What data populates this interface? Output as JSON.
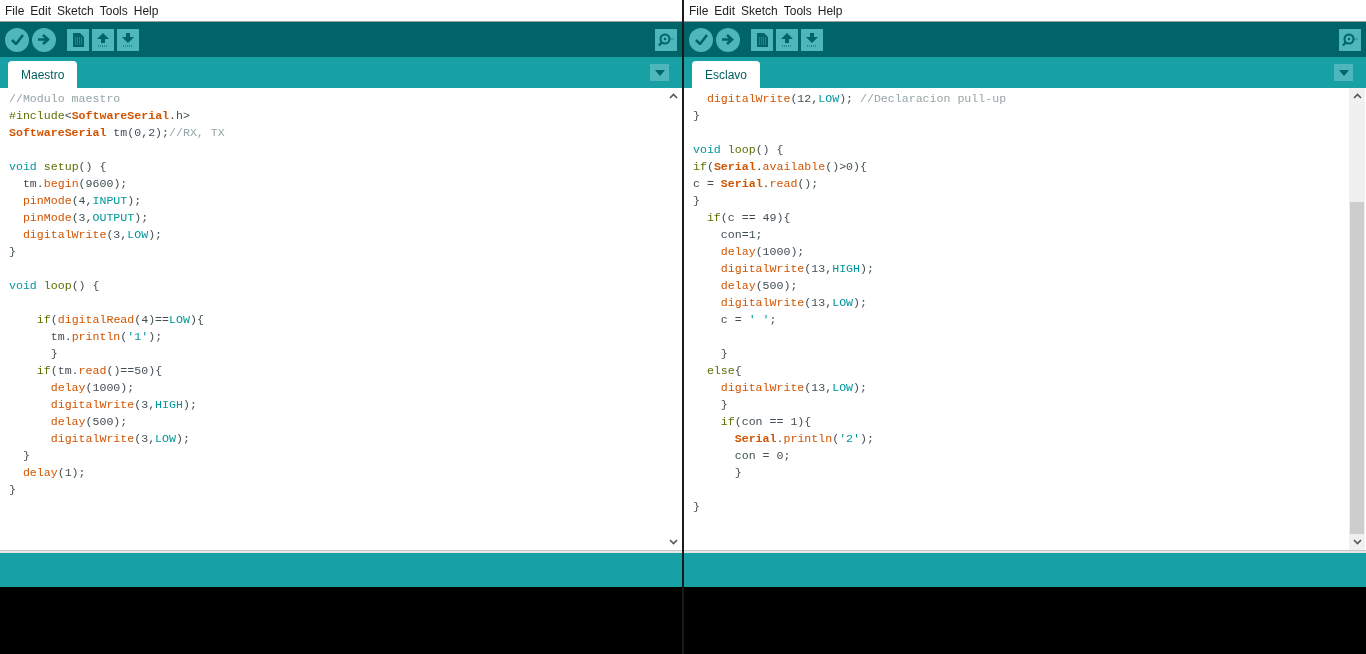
{
  "windows": [
    {
      "menu": [
        "File",
        "Edit",
        "Sketch",
        "Tools",
        "Help"
      ],
      "tabs": [
        {
          "label": "Maestro",
          "selected": true
        }
      ],
      "scroll_thumb": false,
      "lines": [
        {
          "kind": "code",
          "segs": [
            {
              "t": "//Modulo maestro",
              "kind": "comment"
            }
          ]
        },
        {
          "kind": "code",
          "segs": [
            {
              "t": "#include",
              "kind": "pre"
            },
            {
              "t": "<",
              "kind": "plain"
            },
            {
              "t": "SoftwareSerial",
              "kind": "type"
            },
            {
              "t": ".h>",
              "kind": "plain"
            }
          ]
        },
        {
          "kind": "code",
          "segs": [
            {
              "t": "SoftwareSerial",
              "kind": "type"
            },
            {
              "t": " tm(0,2);",
              "kind": "plain"
            },
            {
              "t": "//RX, TX",
              "kind": "comment"
            }
          ]
        },
        {
          "kind": "blank"
        },
        {
          "kind": "code",
          "segs": [
            {
              "t": "void ",
              "kind": "const"
            },
            {
              "t": "setup",
              "kind": "pre"
            },
            {
              "t": "() {",
              "kind": "plain"
            }
          ]
        },
        {
          "kind": "code",
          "segs": [
            {
              "t": "  tm.",
              "kind": "plain"
            },
            {
              "t": "begin",
              "kind": "func"
            },
            {
              "t": "(9600);",
              "kind": "plain"
            }
          ]
        },
        {
          "kind": "code",
          "segs": [
            {
              "t": "  pinMode",
              "kind": "func"
            },
            {
              "t": "(4,",
              "kind": "plain"
            },
            {
              "t": "INPUT",
              "kind": "const"
            },
            {
              "t": ");",
              "kind": "plain"
            }
          ]
        },
        {
          "kind": "code",
          "segs": [
            {
              "t": "  pinMode",
              "kind": "func"
            },
            {
              "t": "(3,",
              "kind": "plain"
            },
            {
              "t": "OUTPUT",
              "kind": "const"
            },
            {
              "t": ");",
              "kind": "plain"
            }
          ]
        },
        {
          "kind": "code",
          "segs": [
            {
              "t": "  digitalWrite",
              "kind": "func"
            },
            {
              "t": "(3,",
              "kind": "plain"
            },
            {
              "t": "LOW",
              "kind": "const"
            },
            {
              "t": ");",
              "kind": "plain"
            }
          ]
        },
        {
          "kind": "code",
          "segs": [
            {
              "t": "}",
              "kind": "plain"
            }
          ]
        },
        {
          "kind": "blank"
        },
        {
          "kind": "code",
          "segs": [
            {
              "t": "void ",
              "kind": "const"
            },
            {
              "t": "loop",
              "kind": "pre"
            },
            {
              "t": "() {",
              "kind": "plain"
            }
          ]
        },
        {
          "kind": "blank"
        },
        {
          "kind": "code",
          "segs": [
            {
              "t": "    if",
              "kind": "pre"
            },
            {
              "t": "(",
              "kind": "plain"
            },
            {
              "t": "digitalRead",
              "kind": "func"
            },
            {
              "t": "(4)==",
              "kind": "plain"
            },
            {
              "t": "LOW",
              "kind": "const"
            },
            {
              "t": "){",
              "kind": "plain"
            }
          ]
        },
        {
          "kind": "code",
          "segs": [
            {
              "t": "      tm.",
              "kind": "plain"
            },
            {
              "t": "println",
              "kind": "func"
            },
            {
              "t": "(",
              "kind": "plain"
            },
            {
              "t": "'1'",
              "kind": "const"
            },
            {
              "t": ");",
              "kind": "plain"
            }
          ]
        },
        {
          "kind": "code",
          "segs": [
            {
              "t": "      }",
              "kind": "plain"
            }
          ]
        },
        {
          "kind": "code",
          "segs": [
            {
              "t": "    if",
              "kind": "pre"
            },
            {
              "t": "(tm.",
              "kind": "plain"
            },
            {
              "t": "read",
              "kind": "func"
            },
            {
              "t": "()==50){",
              "kind": "plain"
            }
          ]
        },
        {
          "kind": "code",
          "segs": [
            {
              "t": "      delay",
              "kind": "func"
            },
            {
              "t": "(1000);",
              "kind": "plain"
            }
          ]
        },
        {
          "kind": "code",
          "segs": [
            {
              "t": "      digitalWrite",
              "kind": "func"
            },
            {
              "t": "(3,",
              "kind": "plain"
            },
            {
              "t": "HIGH",
              "kind": "const"
            },
            {
              "t": ");",
              "kind": "plain"
            }
          ]
        },
        {
          "kind": "code",
          "segs": [
            {
              "t": "      delay",
              "kind": "func"
            },
            {
              "t": "(500);",
              "kind": "plain"
            }
          ]
        },
        {
          "kind": "code",
          "segs": [
            {
              "t": "      digitalWrite",
              "kind": "func"
            },
            {
              "t": "(3,",
              "kind": "plain"
            },
            {
              "t": "LOW",
              "kind": "const"
            },
            {
              "t": ");",
              "kind": "plain"
            }
          ]
        },
        {
          "kind": "code",
          "segs": [
            {
              "t": "  }",
              "kind": "plain"
            }
          ]
        },
        {
          "kind": "code",
          "segs": [
            {
              "t": "  delay",
              "kind": "func"
            },
            {
              "t": "(1);",
              "kind": "plain"
            }
          ]
        },
        {
          "kind": "code",
          "segs": [
            {
              "t": "}",
              "kind": "plain"
            }
          ]
        }
      ]
    },
    {
      "menu": [
        "File",
        "Edit",
        "Sketch",
        "Tools",
        "Help"
      ],
      "tabs": [
        {
          "label": "Esclavo",
          "selected": true
        }
      ],
      "scroll_thumb": true,
      "lines": [
        {
          "kind": "code",
          "segs": [
            {
              "t": "  digitalWrite",
              "kind": "func"
            },
            {
              "t": "(12,",
              "kind": "plain"
            },
            {
              "t": "LOW",
              "kind": "const"
            },
            {
              "t": "); ",
              "kind": "plain"
            },
            {
              "t": "//Declaracion pull-up",
              "kind": "comment"
            }
          ]
        },
        {
          "kind": "code",
          "segs": [
            {
              "t": "}",
              "kind": "plain"
            }
          ]
        },
        {
          "kind": "blank"
        },
        {
          "kind": "code",
          "segs": [
            {
              "t": "void ",
              "kind": "const"
            },
            {
              "t": "loop",
              "kind": "pre"
            },
            {
              "t": "() {",
              "kind": "plain"
            }
          ]
        },
        {
          "kind": "code",
          "segs": [
            {
              "t": "if",
              "kind": "pre"
            },
            {
              "t": "(",
              "kind": "plain"
            },
            {
              "t": "Serial",
              "kind": "type"
            },
            {
              "t": ".",
              "kind": "plain"
            },
            {
              "t": "available",
              "kind": "func"
            },
            {
              "t": "()>0){",
              "kind": "plain"
            }
          ]
        },
        {
          "kind": "code",
          "segs": [
            {
              "t": "c = ",
              "kind": "plain"
            },
            {
              "t": "Serial",
              "kind": "type"
            },
            {
              "t": ".",
              "kind": "plain"
            },
            {
              "t": "read",
              "kind": "func"
            },
            {
              "t": "();",
              "kind": "plain"
            }
          ]
        },
        {
          "kind": "code",
          "segs": [
            {
              "t": "}",
              "kind": "plain"
            }
          ]
        },
        {
          "kind": "code",
          "segs": [
            {
              "t": "  if",
              "kind": "pre"
            },
            {
              "t": "(c == 49){",
              "kind": "plain"
            }
          ]
        },
        {
          "kind": "code",
          "segs": [
            {
              "t": "    con=1;",
              "kind": "plain"
            }
          ]
        },
        {
          "kind": "code",
          "segs": [
            {
              "t": "    delay",
              "kind": "func"
            },
            {
              "t": "(1000);",
              "kind": "plain"
            }
          ]
        },
        {
          "kind": "code",
          "segs": [
            {
              "t": "    digitalWrite",
              "kind": "func"
            },
            {
              "t": "(13,",
              "kind": "plain"
            },
            {
              "t": "HIGH",
              "kind": "const"
            },
            {
              "t": ");",
              "kind": "plain"
            }
          ]
        },
        {
          "kind": "code",
          "segs": [
            {
              "t": "    delay",
              "kind": "func"
            },
            {
              "t": "(500);",
              "kind": "plain"
            }
          ]
        },
        {
          "kind": "code",
          "segs": [
            {
              "t": "    digitalWrite",
              "kind": "func"
            },
            {
              "t": "(13,",
              "kind": "plain"
            },
            {
              "t": "LOW",
              "kind": "const"
            },
            {
              "t": ");",
              "kind": "plain"
            }
          ]
        },
        {
          "kind": "code",
          "segs": [
            {
              "t": "    c = ",
              "kind": "plain"
            },
            {
              "t": "' '",
              "kind": "const"
            },
            {
              "t": ";",
              "kind": "plain"
            }
          ]
        },
        {
          "kind": "blank"
        },
        {
          "kind": "code",
          "segs": [
            {
              "t": "    }",
              "kind": "plain"
            }
          ]
        },
        {
          "kind": "code",
          "segs": [
            {
              "t": "  else",
              "kind": "pre"
            },
            {
              "t": "{",
              "kind": "plain"
            }
          ]
        },
        {
          "kind": "code",
          "segs": [
            {
              "t": "    digitalWrite",
              "kind": "func"
            },
            {
              "t": "(13,",
              "kind": "plain"
            },
            {
              "t": "LOW",
              "kind": "const"
            },
            {
              "t": ");",
              "kind": "plain"
            }
          ]
        },
        {
          "kind": "code",
          "segs": [
            {
              "t": "    }",
              "kind": "plain"
            }
          ]
        },
        {
          "kind": "code",
          "segs": [
            {
              "t": "    if",
              "kind": "pre"
            },
            {
              "t": "(con == 1){",
              "kind": "plain"
            }
          ]
        },
        {
          "kind": "code",
          "segs": [
            {
              "t": "      Serial",
              "kind": "type"
            },
            {
              "t": ".",
              "kind": "plain"
            },
            {
              "t": "println",
              "kind": "func"
            },
            {
              "t": "(",
              "kind": "plain"
            },
            {
              "t": "'2'",
              "kind": "const"
            },
            {
              "t": ");",
              "kind": "plain"
            }
          ]
        },
        {
          "kind": "code",
          "segs": [
            {
              "t": "      con = 0;",
              "kind": "plain"
            }
          ]
        },
        {
          "kind": "code",
          "segs": [
            {
              "t": "      }",
              "kind": "plain"
            }
          ]
        },
        {
          "kind": "blank"
        },
        {
          "kind": "code",
          "segs": [
            {
              "t": "}",
              "kind": "plain"
            }
          ]
        }
      ]
    }
  ]
}
